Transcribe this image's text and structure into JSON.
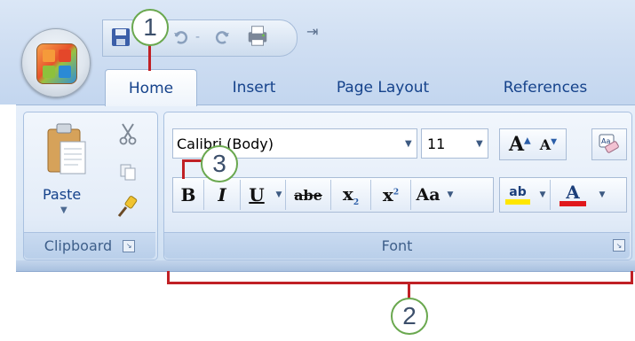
{
  "quick_access_toolbar": {
    "icons": [
      "save-icon",
      "undo-icon",
      "redo-icon",
      "quick-print-icon",
      "customize-qat-icon"
    ],
    "undo_sep": "-",
    "customize_glyph": "⇥"
  },
  "tabs": [
    {
      "label": "Home",
      "active": true
    },
    {
      "label": "Insert",
      "active": false
    },
    {
      "label": "Page Layout",
      "active": false
    },
    {
      "label": "References",
      "active": false
    }
  ],
  "groups": {
    "clipboard": {
      "label": "Clipboard",
      "paste_label": "Paste",
      "paste_arrow": "▼"
    },
    "font": {
      "label": "Font",
      "font_name": "Calibri (Body)",
      "font_size": "11",
      "bold": "B",
      "italic": "I",
      "underline": "U",
      "strikethrough": "abe",
      "subscript": "x",
      "subscript_mark": "2",
      "superscript": "x",
      "superscript_mark": "2",
      "change_case": "Aa",
      "grow_font": "A",
      "shrink_font": "A",
      "highlight": "ab",
      "font_color": "A",
      "clear_format": "Aa"
    }
  },
  "callouts": {
    "one": "1",
    "two": "2",
    "three": "3"
  },
  "colors": {
    "callout_border": "#6aa84f",
    "leader_line": "#c02025",
    "highlight_yellow": "#ffe600",
    "font_color_red": "#e0181d"
  }
}
